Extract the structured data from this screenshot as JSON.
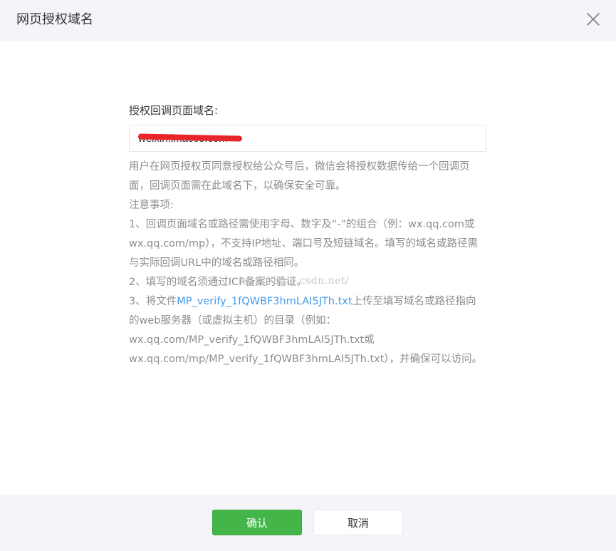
{
  "dialog": {
    "title": "网页授权域名",
    "close_icon": "close-icon"
  },
  "form": {
    "label": "授权回调页面域名:",
    "input_value": "weixin.imacco.com"
  },
  "tips": {
    "line1": "用户在网页授权页同意授权给公众号后，微信会将授权数据传给一个回调页面，回调页面需在此域名下，以确保安全可靠。",
    "notice_title": "注意事项:",
    "item1": "1、回调页面域名或路径需使用字母、数字及“-”的组合（例：wx.qq.com或wx.qq.com/mp），不支持IP地址、端口号及短链域名。填写的域名或路径需与实际回调URL中的域名或路径相同。",
    "item2": "2、填写的域名须通过ICP备案的验证。",
    "item3_prefix": "3、将文件",
    "item3_link": "MP_verify_1fQWBF3hmLAI5JTh.txt",
    "item3_suffix": "上传至填写域名或路径指向的web服务器（或虚拟主机）的目录（例如：wx.qq.com/MP_verify_1fQWBF3hmLAI5JTh.txt或wx.qq.com/mp/MP_verify_1fQWBF3hmLAI5JTh.txt），并确保可以访问。"
  },
  "watermark": "http://blog.csdn.net/",
  "footer": {
    "confirm_label": "确认",
    "cancel_label": "取消"
  },
  "colors": {
    "primary": "#44b549",
    "link": "#459ae9",
    "header_bg": "#f4f5f9",
    "redaction": "#e8252b"
  }
}
